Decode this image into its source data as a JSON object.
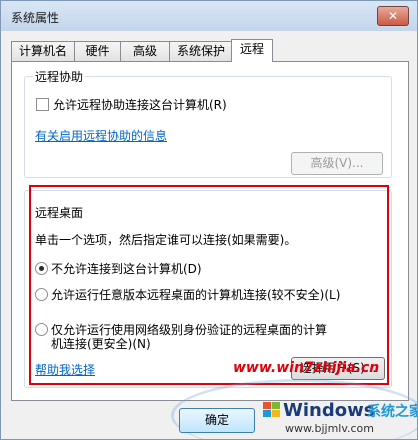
{
  "window": {
    "title": "系统属性",
    "close_label": "✕"
  },
  "tabs": [
    {
      "label": "计算机名"
    },
    {
      "label": "硬件"
    },
    {
      "label": "高级"
    },
    {
      "label": "系统保护"
    },
    {
      "label": "远程",
      "active": true
    }
  ],
  "remote_assistance": {
    "legend": "远程协助",
    "checkbox_label": "允许远程协助连接这台计算机(R)",
    "checkbox_checked": false,
    "info_link": "有关启用远程协助的信息",
    "advanced_button": "高级(V)..."
  },
  "remote_desktop": {
    "legend": "远程桌面",
    "instruction": "单击一个选项，然后指定谁可以连接(如果需要)。",
    "options": [
      {
        "label": "不允许连接到这台计算机(D)",
        "selected": true
      },
      {
        "label": "允许运行任意版本远程桌面的计算机连接(较不安全)(L)",
        "selected": false
      },
      {
        "label_line1": "仅允许运行使用网络级别身份验证的远程桌面的计算",
        "label_line2": "机连接(更安全)(N)",
        "selected": false
      }
    ],
    "help_link": "帮助我选择",
    "select_users_button": "选择用户(S)..."
  },
  "footer": {
    "ok_button": "确定"
  },
  "watermark": {
    "site": "www.win7zhijia.cn",
    "windows": "Windows",
    "cn": "系统之家",
    "url": "www.bjjmlv.com"
  },
  "colors": {
    "highlight_box": "#e0000c",
    "link": "#0066cc"
  }
}
